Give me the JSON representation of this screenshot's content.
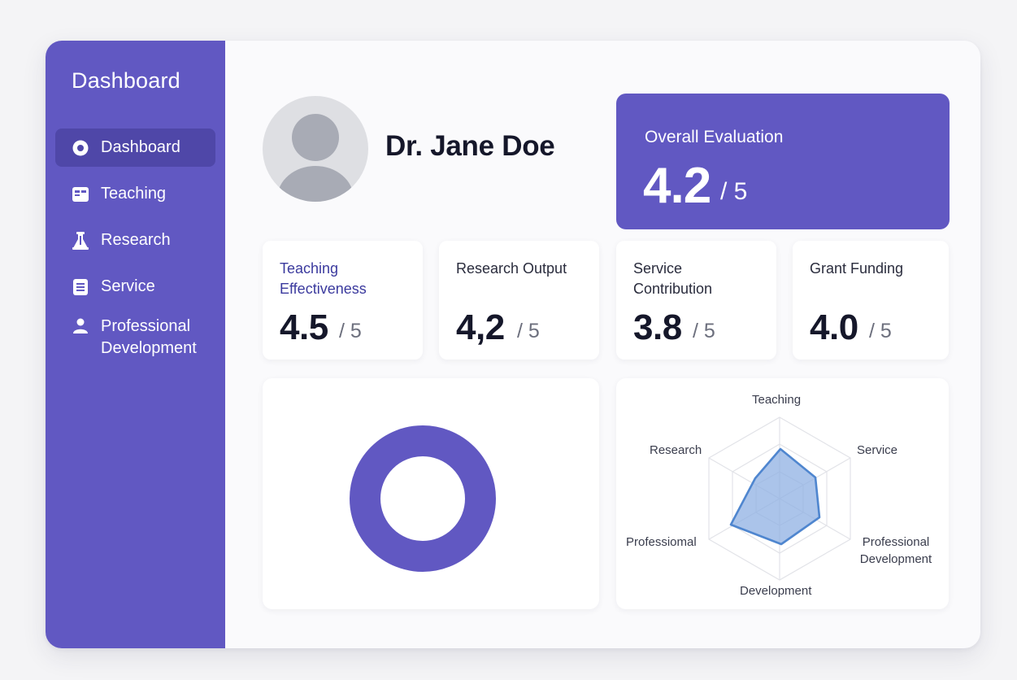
{
  "sidebar": {
    "title": "Dashboard",
    "items": [
      {
        "label": "Dashboard",
        "icon": "dashboard-circle-icon",
        "active": true
      },
      {
        "label": "Teaching",
        "icon": "calendar-card-icon",
        "active": false
      },
      {
        "label": "Research",
        "icon": "flask-icon",
        "active": false
      },
      {
        "label": "Service",
        "icon": "document-icon",
        "active": false
      },
      {
        "label": "Professional Development",
        "icon": "user-icon",
        "active": false
      }
    ]
  },
  "profile": {
    "name": "Dr. Jane Doe"
  },
  "overall": {
    "label": "Overall Evaluation",
    "value": "4.2",
    "denominator": "/ 5"
  },
  "kpis": [
    {
      "label": "Teaching Effectiveness",
      "value": "4.5",
      "denominator": "/ 5"
    },
    {
      "label": "Research Output",
      "value": "4,2",
      "denominator": "/ 5"
    },
    {
      "label": "Service Contribution",
      "value": "3.8",
      "denominator": "/ 5"
    },
    {
      "label": "Grant Funding",
      "value": "4.0",
      "denominator": "/ 5"
    }
  ],
  "radar": {
    "labels": [
      "Teaching",
      "Service",
      "Professional Development",
      "Development",
      "Professiomal",
      "Research"
    ]
  },
  "colors": {
    "accent": "#6158c2",
    "accent_dark": "#4f47a8",
    "radar_fill": "#8fb0e3",
    "radar_stroke": "#4f86cf"
  }
}
